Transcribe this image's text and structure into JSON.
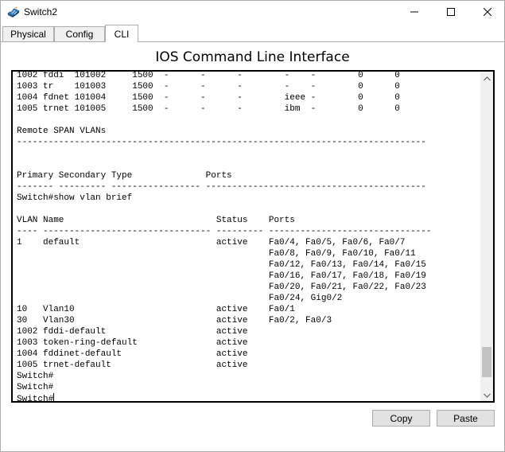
{
  "window": {
    "title": "Switch2",
    "controls": {
      "minimize_icon": "minimize-icon",
      "maximize_icon": "maximize-icon",
      "close_icon": "close-icon"
    }
  },
  "tabs": [
    {
      "label": "Physical",
      "active": false
    },
    {
      "label": "Config",
      "active": false
    },
    {
      "label": "CLI",
      "active": true
    }
  ],
  "panel": {
    "title": "IOS Command Line Interface"
  },
  "terminal": {
    "lines": [
      "1002 fddi  101002     1500  -      -      -        -    -        0      0",
      "1003 tr    101003     1500  -      -      -        -    -        0      0",
      "1004 fdnet 101004     1500  -      -      -        ieee -        0      0",
      "1005 trnet 101005     1500  -      -      -        ibm  -        0      0",
      "",
      "Remote SPAN VLANs",
      "------------------------------------------------------------------------------",
      "",
      "",
      "Primary Secondary Type              Ports",
      "------- --------- ----------------- ------------------------------------------",
      "Switch#show vlan brief",
      "",
      "VLAN Name                             Status    Ports",
      "---- -------------------------------- --------- -------------------------------",
      "1    default                          active    Fa0/4, Fa0/5, Fa0/6, Fa0/7",
      "                                                Fa0/8, Fa0/9, Fa0/10, Fa0/11",
      "                                                Fa0/12, Fa0/13, Fa0/14, Fa0/15",
      "                                                Fa0/16, Fa0/17, Fa0/18, Fa0/19",
      "                                                Fa0/20, Fa0/21, Fa0/22, Fa0/23",
      "                                                Fa0/24, Gig0/2",
      "10   Vlan10                           active    Fa0/1",
      "30   Vlan30                           active    Fa0/2, Fa0/3",
      "1002 fddi-default                     active",
      "1003 token-ring-default               active",
      "1004 fddinet-default                  active",
      "1005 trnet-default                    active",
      "Switch#",
      "Switch#",
      "Switch#"
    ]
  },
  "buttons": {
    "copy": "Copy",
    "paste": "Paste"
  }
}
